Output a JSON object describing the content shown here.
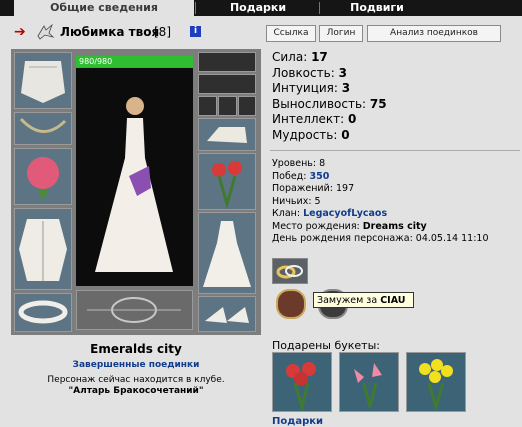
{
  "tabs": [
    "Общие сведения",
    "Подарки",
    "Подвиги"
  ],
  "header": {
    "nick": "Любимка твоя",
    "level": "[8]",
    "info": "i"
  },
  "buttons": [
    "Ссылка",
    "Логин",
    "Анализ поединков"
  ],
  "hp": "980/980",
  "stats": [
    {
      "label": "Сила:",
      "value": "17"
    },
    {
      "label": "Ловкость:",
      "value": "3"
    },
    {
      "label": "Интуиция:",
      "value": "3"
    },
    {
      "label": "Выносливость:",
      "value": "75"
    },
    {
      "label": "Интеллект:",
      "value": "0"
    },
    {
      "label": "Мудрость:",
      "value": "0"
    }
  ],
  "info": {
    "level": "Уровень: 8",
    "wins_label": "Побед:",
    "wins": "350",
    "losses": "Поражений: 197",
    "draws": "Ничьих: 5",
    "clan_label": "Клан:",
    "clan": "LegacyofLycaos",
    "birthplace_label": "Место рождения:",
    "birthplace": "Dreams city",
    "birthday": "День рождения персонажа: 04.05.14 11:10"
  },
  "tooltip": {
    "prefix": "Замужем за",
    "name": "CIAU"
  },
  "city": "Emeralds city",
  "finished_fights": "Завершенные поединки",
  "location_line1": "Персонаж сейчас находится в клубе.",
  "location_line2": "\"Алтарь Бракосочетаний\"",
  "bouquets_title": "Подарены букеты:",
  "gifts_link": "Подарки",
  "colors": {
    "hp": "#2fbe31",
    "link": "#123d8c",
    "tabs_bg": "#151515"
  }
}
